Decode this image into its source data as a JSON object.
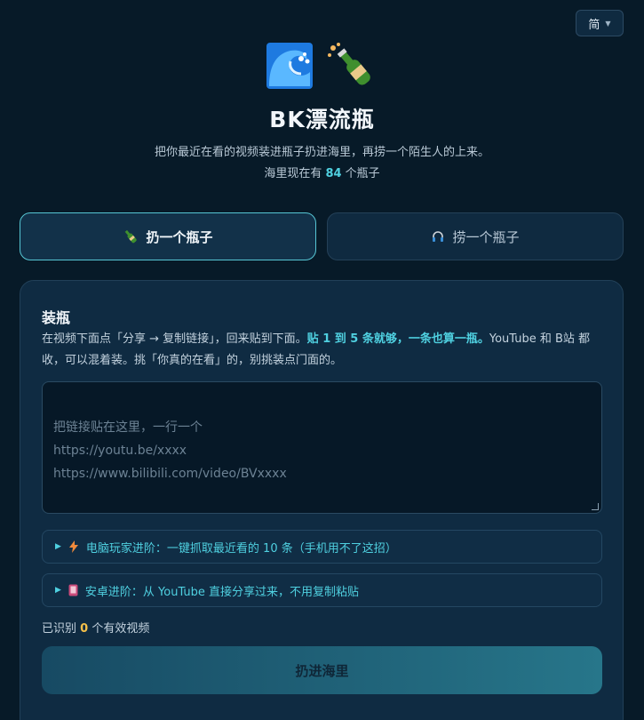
{
  "lang_switch": {
    "label": "简"
  },
  "header": {
    "title": "BK漂流瓶",
    "subtitle": "把你最近在看的视频装进瓶子扔进海里，再捞一个陌生人的上来。",
    "count_prefix": "海里现在有 ",
    "count": "84",
    "count_suffix": " 个瓶子"
  },
  "tabs": [
    {
      "label": "扔一个瓶子",
      "icon": "bottle-icon",
      "active": true
    },
    {
      "label": "捞一个瓶子",
      "icon": "headphones-icon",
      "active": false
    }
  ],
  "form": {
    "title": "装瓶",
    "desc_1": "在视频下面点「分享 → 复制链接」，回来贴到下面。",
    "desc_bold": "贴 1 到 5 条就够，一条也算一瓶。",
    "desc_2": "YouTube 和 B站 都收，可以混着装。挑「你真的在看」的，别挑装点门面的。",
    "placeholder": "把链接贴在这里，一行一个\nhttps://youtu.be/xxxx\nhttps://www.bilibili.com/video/BVxxxx",
    "details": [
      {
        "label": "电脑玩家进阶：一键抓取最近看的 10 条（手机用不了这招）",
        "icon": "lightning-icon"
      },
      {
        "label": "安卓进阶：从 YouTube 直接分享过来，不用复制粘贴",
        "icon": "phone-icon"
      }
    ],
    "recognized_prefix": "已识别 ",
    "recognized_count": "0",
    "recognized_suffix": " 个有效视频",
    "submit_label": "扔进海里"
  },
  "colors": {
    "accent": "#4fd0e0",
    "count_highlight": "#f4c04a",
    "background": "#071a28"
  }
}
